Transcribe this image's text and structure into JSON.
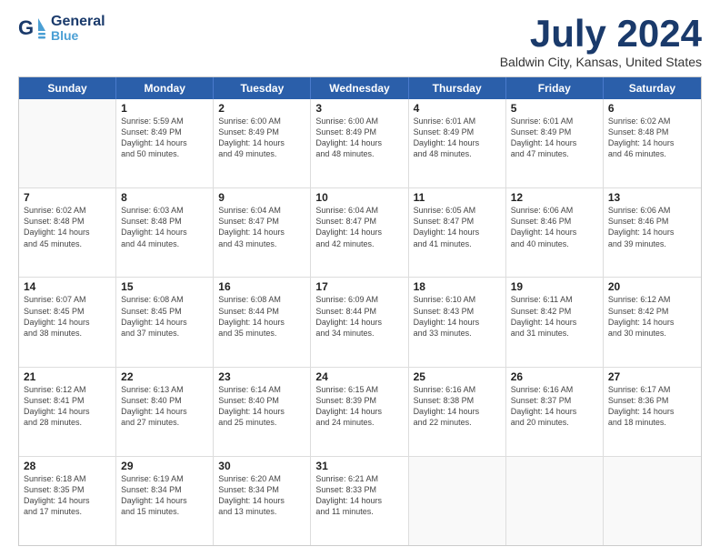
{
  "header": {
    "logo_general": "General",
    "logo_blue": "Blue",
    "month_title": "July 2024",
    "location": "Baldwin City, Kansas, United States"
  },
  "weekdays": [
    "Sunday",
    "Monday",
    "Tuesday",
    "Wednesday",
    "Thursday",
    "Friday",
    "Saturday"
  ],
  "rows": [
    [
      {
        "day": "",
        "empty": true
      },
      {
        "day": "1",
        "sunrise": "Sunrise: 5:59 AM",
        "sunset": "Sunset: 8:49 PM",
        "daylight": "Daylight: 14 hours",
        "minutes": "and 50 minutes."
      },
      {
        "day": "2",
        "sunrise": "Sunrise: 6:00 AM",
        "sunset": "Sunset: 8:49 PM",
        "daylight": "Daylight: 14 hours",
        "minutes": "and 49 minutes."
      },
      {
        "day": "3",
        "sunrise": "Sunrise: 6:00 AM",
        "sunset": "Sunset: 8:49 PM",
        "daylight": "Daylight: 14 hours",
        "minutes": "and 48 minutes."
      },
      {
        "day": "4",
        "sunrise": "Sunrise: 6:01 AM",
        "sunset": "Sunset: 8:49 PM",
        "daylight": "Daylight: 14 hours",
        "minutes": "and 48 minutes."
      },
      {
        "day": "5",
        "sunrise": "Sunrise: 6:01 AM",
        "sunset": "Sunset: 8:49 PM",
        "daylight": "Daylight: 14 hours",
        "minutes": "and 47 minutes."
      },
      {
        "day": "6",
        "sunrise": "Sunrise: 6:02 AM",
        "sunset": "Sunset: 8:48 PM",
        "daylight": "Daylight: 14 hours",
        "minutes": "and 46 minutes."
      }
    ],
    [
      {
        "day": "7",
        "sunrise": "Sunrise: 6:02 AM",
        "sunset": "Sunset: 8:48 PM",
        "daylight": "Daylight: 14 hours",
        "minutes": "and 45 minutes."
      },
      {
        "day": "8",
        "sunrise": "Sunrise: 6:03 AM",
        "sunset": "Sunset: 8:48 PM",
        "daylight": "Daylight: 14 hours",
        "minutes": "and 44 minutes."
      },
      {
        "day": "9",
        "sunrise": "Sunrise: 6:04 AM",
        "sunset": "Sunset: 8:47 PM",
        "daylight": "Daylight: 14 hours",
        "minutes": "and 43 minutes."
      },
      {
        "day": "10",
        "sunrise": "Sunrise: 6:04 AM",
        "sunset": "Sunset: 8:47 PM",
        "daylight": "Daylight: 14 hours",
        "minutes": "and 42 minutes."
      },
      {
        "day": "11",
        "sunrise": "Sunrise: 6:05 AM",
        "sunset": "Sunset: 8:47 PM",
        "daylight": "Daylight: 14 hours",
        "minutes": "and 41 minutes."
      },
      {
        "day": "12",
        "sunrise": "Sunrise: 6:06 AM",
        "sunset": "Sunset: 8:46 PM",
        "daylight": "Daylight: 14 hours",
        "minutes": "and 40 minutes."
      },
      {
        "day": "13",
        "sunrise": "Sunrise: 6:06 AM",
        "sunset": "Sunset: 8:46 PM",
        "daylight": "Daylight: 14 hours",
        "minutes": "and 39 minutes."
      }
    ],
    [
      {
        "day": "14",
        "sunrise": "Sunrise: 6:07 AM",
        "sunset": "Sunset: 8:45 PM",
        "daylight": "Daylight: 14 hours",
        "minutes": "and 38 minutes."
      },
      {
        "day": "15",
        "sunrise": "Sunrise: 6:08 AM",
        "sunset": "Sunset: 8:45 PM",
        "daylight": "Daylight: 14 hours",
        "minutes": "and 37 minutes."
      },
      {
        "day": "16",
        "sunrise": "Sunrise: 6:08 AM",
        "sunset": "Sunset: 8:44 PM",
        "daylight": "Daylight: 14 hours",
        "minutes": "and 35 minutes."
      },
      {
        "day": "17",
        "sunrise": "Sunrise: 6:09 AM",
        "sunset": "Sunset: 8:44 PM",
        "daylight": "Daylight: 14 hours",
        "minutes": "and 34 minutes."
      },
      {
        "day": "18",
        "sunrise": "Sunrise: 6:10 AM",
        "sunset": "Sunset: 8:43 PM",
        "daylight": "Daylight: 14 hours",
        "minutes": "and 33 minutes."
      },
      {
        "day": "19",
        "sunrise": "Sunrise: 6:11 AM",
        "sunset": "Sunset: 8:42 PM",
        "daylight": "Daylight: 14 hours",
        "minutes": "and 31 minutes."
      },
      {
        "day": "20",
        "sunrise": "Sunrise: 6:12 AM",
        "sunset": "Sunset: 8:42 PM",
        "daylight": "Daylight: 14 hours",
        "minutes": "and 30 minutes."
      }
    ],
    [
      {
        "day": "21",
        "sunrise": "Sunrise: 6:12 AM",
        "sunset": "Sunset: 8:41 PM",
        "daylight": "Daylight: 14 hours",
        "minutes": "and 28 minutes."
      },
      {
        "day": "22",
        "sunrise": "Sunrise: 6:13 AM",
        "sunset": "Sunset: 8:40 PM",
        "daylight": "Daylight: 14 hours",
        "minutes": "and 27 minutes."
      },
      {
        "day": "23",
        "sunrise": "Sunrise: 6:14 AM",
        "sunset": "Sunset: 8:40 PM",
        "daylight": "Daylight: 14 hours",
        "minutes": "and 25 minutes."
      },
      {
        "day": "24",
        "sunrise": "Sunrise: 6:15 AM",
        "sunset": "Sunset: 8:39 PM",
        "daylight": "Daylight: 14 hours",
        "minutes": "and 24 minutes."
      },
      {
        "day": "25",
        "sunrise": "Sunrise: 6:16 AM",
        "sunset": "Sunset: 8:38 PM",
        "daylight": "Daylight: 14 hours",
        "minutes": "and 22 minutes."
      },
      {
        "day": "26",
        "sunrise": "Sunrise: 6:16 AM",
        "sunset": "Sunset: 8:37 PM",
        "daylight": "Daylight: 14 hours",
        "minutes": "and 20 minutes."
      },
      {
        "day": "27",
        "sunrise": "Sunrise: 6:17 AM",
        "sunset": "Sunset: 8:36 PM",
        "daylight": "Daylight: 14 hours",
        "minutes": "and 18 minutes."
      }
    ],
    [
      {
        "day": "28",
        "sunrise": "Sunrise: 6:18 AM",
        "sunset": "Sunset: 8:35 PM",
        "daylight": "Daylight: 14 hours",
        "minutes": "and 17 minutes."
      },
      {
        "day": "29",
        "sunrise": "Sunrise: 6:19 AM",
        "sunset": "Sunset: 8:34 PM",
        "daylight": "Daylight: 14 hours",
        "minutes": "and 15 minutes."
      },
      {
        "day": "30",
        "sunrise": "Sunrise: 6:20 AM",
        "sunset": "Sunset: 8:34 PM",
        "daylight": "Daylight: 14 hours",
        "minutes": "and 13 minutes."
      },
      {
        "day": "31",
        "sunrise": "Sunrise: 6:21 AM",
        "sunset": "Sunset: 8:33 PM",
        "daylight": "Daylight: 14 hours",
        "minutes": "and 11 minutes."
      },
      {
        "day": "",
        "empty": true
      },
      {
        "day": "",
        "empty": true
      },
      {
        "day": "",
        "empty": true
      }
    ]
  ]
}
